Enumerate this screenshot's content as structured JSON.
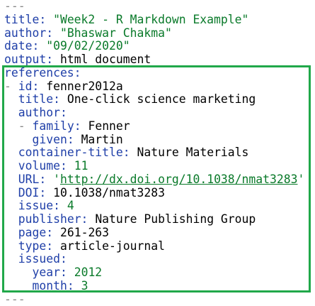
{
  "document": {
    "lines": [
      {
        "indent": 0,
        "parts": [
          {
            "cls": "dash",
            "text": "---"
          }
        ]
      },
      {
        "indent": 0,
        "parts": [
          {
            "cls": "k",
            "text": "title: "
          },
          {
            "cls": "s",
            "text": "\"Week2 - R Markdown Example\""
          }
        ]
      },
      {
        "indent": 0,
        "parts": [
          {
            "cls": "k",
            "text": "author: "
          },
          {
            "cls": "s",
            "text": "\"Bhaswar Chakma\""
          }
        ]
      },
      {
        "indent": 0,
        "parts": [
          {
            "cls": "k",
            "text": "date: "
          },
          {
            "cls": "s",
            "text": "\"09/02/2020\""
          }
        ]
      },
      {
        "indent": 0,
        "parts": [
          {
            "cls": "k",
            "text": "output: "
          },
          {
            "cls": "t",
            "text": "html_document"
          }
        ]
      },
      {
        "indent": 0,
        "parts": [
          {
            "cls": "k",
            "text": "references:"
          }
        ]
      },
      {
        "indent": 0,
        "parts": [
          {
            "cls": "dash",
            "text": "- "
          },
          {
            "cls": "k",
            "text": "id: "
          },
          {
            "cls": "t",
            "text": "fenner2012a"
          }
        ]
      },
      {
        "indent": 2,
        "parts": [
          {
            "cls": "k",
            "text": "title: "
          },
          {
            "cls": "t",
            "text": "One-click science marketing"
          }
        ]
      },
      {
        "indent": 2,
        "parts": [
          {
            "cls": "k",
            "text": "author:"
          }
        ]
      },
      {
        "indent": 2,
        "parts": [
          {
            "cls": "dash",
            "text": "- "
          },
          {
            "cls": "k",
            "text": "family: "
          },
          {
            "cls": "t",
            "text": "Fenner"
          }
        ]
      },
      {
        "indent": 4,
        "parts": [
          {
            "cls": "k",
            "text": "given: "
          },
          {
            "cls": "t",
            "text": "Martin"
          }
        ]
      },
      {
        "indent": 2,
        "parts": [
          {
            "cls": "k",
            "text": "container-title: "
          },
          {
            "cls": "t",
            "text": "Nature Materials"
          }
        ]
      },
      {
        "indent": 2,
        "parts": [
          {
            "cls": "k",
            "text": "volume: "
          },
          {
            "cls": "v",
            "text": "11"
          }
        ]
      },
      {
        "indent": 2,
        "parts": [
          {
            "cls": "k",
            "text": "URL: "
          },
          {
            "cls": "s",
            "text": "'"
          },
          {
            "cls": "url",
            "text": "http://dx.doi.org/10.1038/nmat3283"
          },
          {
            "cls": "s",
            "text": "'"
          }
        ]
      },
      {
        "indent": 2,
        "parts": [
          {
            "cls": "k",
            "text": "DOI: "
          },
          {
            "cls": "t",
            "text": "10.1038/nmat3283"
          }
        ]
      },
      {
        "indent": 2,
        "parts": [
          {
            "cls": "k",
            "text": "issue: "
          },
          {
            "cls": "v",
            "text": "4"
          }
        ]
      },
      {
        "indent": 2,
        "parts": [
          {
            "cls": "k",
            "text": "publisher: "
          },
          {
            "cls": "t",
            "text": "Nature Publishing Group"
          }
        ]
      },
      {
        "indent": 2,
        "parts": [
          {
            "cls": "k",
            "text": "page: "
          },
          {
            "cls": "t",
            "text": "261-263"
          }
        ]
      },
      {
        "indent": 2,
        "parts": [
          {
            "cls": "k",
            "text": "type: "
          },
          {
            "cls": "t",
            "text": "article-journal"
          }
        ]
      },
      {
        "indent": 2,
        "parts": [
          {
            "cls": "k",
            "text": "issued:"
          }
        ]
      },
      {
        "indent": 4,
        "parts": [
          {
            "cls": "k",
            "text": "year: "
          },
          {
            "cls": "v",
            "text": "2012"
          }
        ]
      },
      {
        "indent": 4,
        "parts": [
          {
            "cls": "k",
            "text": "month: "
          },
          {
            "cls": "v",
            "text": "3"
          }
        ]
      },
      {
        "indent": 0,
        "parts": [
          {
            "cls": "dash",
            "text": "---"
          }
        ]
      }
    ]
  },
  "colors": {
    "highlight_border": "#21a84a",
    "key": "#1f3fa8",
    "string": "#0a7a2a"
  }
}
